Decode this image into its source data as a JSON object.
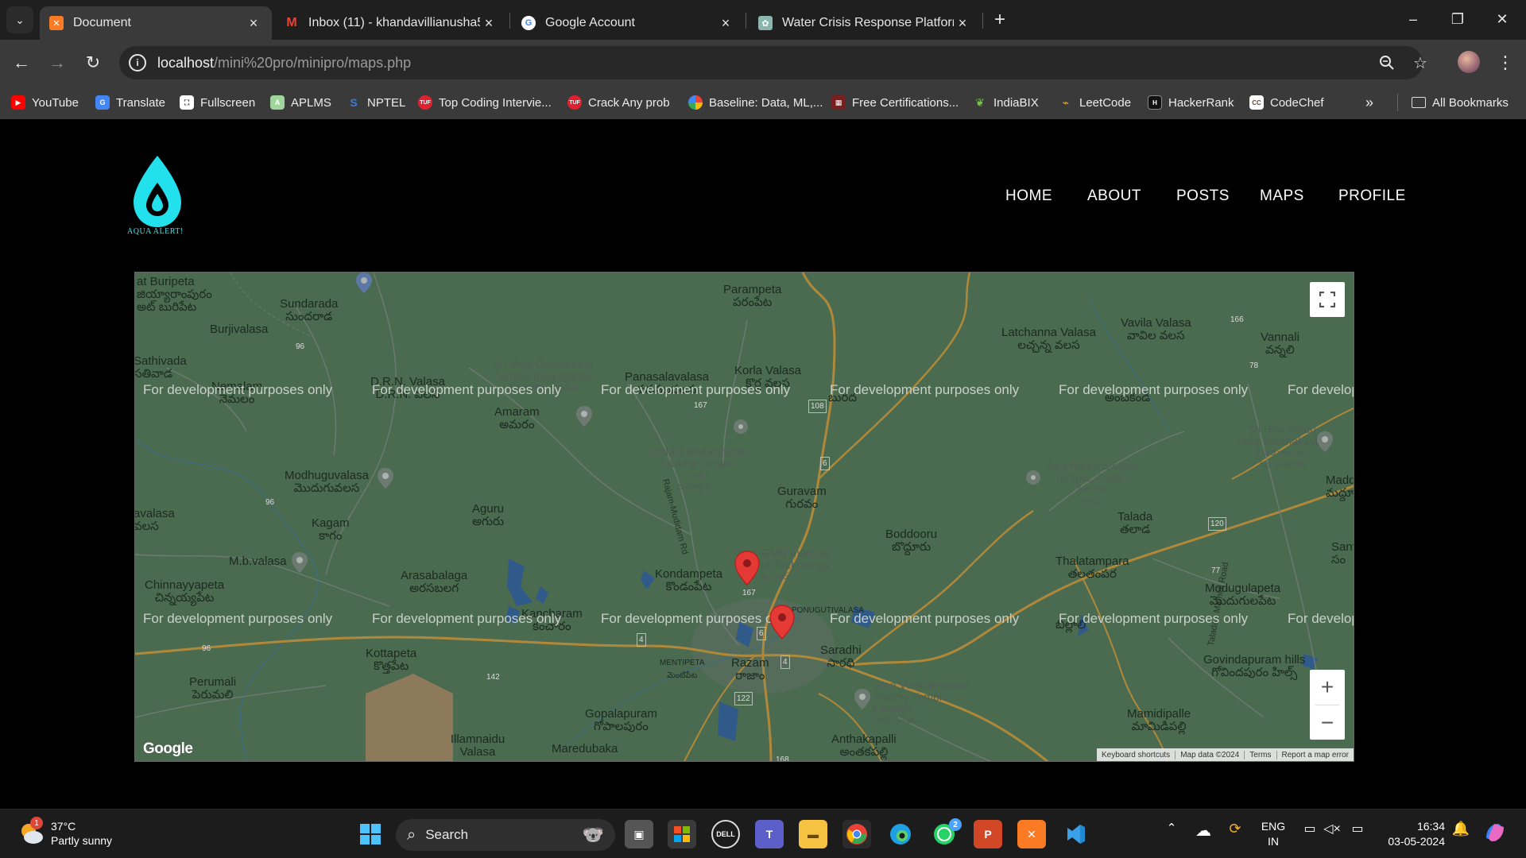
{
  "browser": {
    "tabs": [
      {
        "title": "Document",
        "active": true
      },
      {
        "title": "Inbox (11) - khandavillianusha5"
      },
      {
        "title": "Google Account"
      },
      {
        "title": "Water Crisis Response Platform"
      }
    ],
    "url_host": "localhost",
    "url_path": "/mini%20pro/minipro/maps.php",
    "bookmarks": [
      "YouTube",
      "Translate",
      "Fullscreen",
      "APLMS",
      "NPTEL",
      "Top Coding Intervie...",
      "Crack Any prob",
      "Baseline: Data, ML,...",
      "Free Certifications...",
      "IndiaBIX",
      "LeetCode",
      "HackerRank",
      "CodeChef"
    ],
    "all_bookmarks": "All Bookmarks"
  },
  "site": {
    "logo_text": "AQUA ALERT!",
    "nav": [
      "HOME",
      "ABOUT",
      "POSTS",
      "MAPS",
      "PROFILE"
    ]
  },
  "map": {
    "places": [
      {
        "name": "at Buripeta",
        "sub": "జియ్యారాంపురం\nఅట్ బురిపేట"
      },
      {
        "name": "Sundarada",
        "sub": "సుందరాడ"
      },
      {
        "name": "Burjivalasa"
      },
      {
        "name": "Sathivada",
        "sub": "సతివాడ"
      },
      {
        "name": "Nemalam",
        "sub": "నెమలం"
      },
      {
        "name": "D.R.N. Valasa",
        "sub": "D.R.N. వలస"
      },
      {
        "name": "Parampeta",
        "sub": "పరంపేట"
      },
      {
        "name": "Panasalavalasa",
        "sub": "పనసలవలస"
      },
      {
        "name": "Korla Valasa",
        "sub": "కొర్ల వలస"
      },
      {
        "name": "Latchanna Valasa",
        "sub": "లచ్చన్న వలస"
      },
      {
        "name": "Vavila Valasa",
        "sub": "వావిల వలస"
      },
      {
        "name": "Vannali",
        "sub": "వన్నలి"
      },
      {
        "name": "Amaram",
        "sub": "అమరం"
      },
      {
        "name": "Burada",
        "sub": "బురద"
      },
      {
        "name": "Ambakandi",
        "sub": "అంబకండి"
      },
      {
        "name": "Modhuguvalasa",
        "sub": "మొదుగువలస"
      },
      {
        "name": "Guravam",
        "sub": "గురవం"
      },
      {
        "name": "Aguru",
        "sub": "అగురు"
      },
      {
        "name": "Kagam",
        "sub": "కాగం"
      },
      {
        "name": "avalasa",
        "sub": "వలస"
      },
      {
        "name": "M.b.valasa"
      },
      {
        "name": "Arasabalaga",
        "sub": "అరసబలగ"
      },
      {
        "name": "Kondampeta",
        "sub": "కొండంపేట"
      },
      {
        "name": "Boddooru",
        "sub": "బొద్దూరు"
      },
      {
        "name": "Talada",
        "sub": "తలాడ"
      },
      {
        "name": "Thalatampara",
        "sub": "తలతంపర"
      },
      {
        "name": "Modugulapeta",
        "sub": "మొదుగులపేట"
      },
      {
        "name": "Chinnayyapeta",
        "sub": "చిన్నయ్యపేట"
      },
      {
        "name": "Kancharam",
        "sub": "కంచారం"
      },
      {
        "name": "Kottapeta",
        "sub": "కొత్తపేట"
      },
      {
        "name": "Razam",
        "sub": "రాజాం"
      },
      {
        "name": "Saradhi",
        "sub": "సారధి"
      },
      {
        "name": "Billali",
        "sub": "బిల్లాలి"
      },
      {
        "name": "Govindapuram hills",
        "sub": "గోవిందపురం హిల్స్"
      },
      {
        "name": "Perumali",
        "sub": "పెరుమలి"
      },
      {
        "name": "Gopalapuram",
        "sub": "గోపాలపురం"
      },
      {
        "name": "Mamidipalle",
        "sub": "మామిడిపల్లి"
      },
      {
        "name": "Illamnaidu Valasa"
      },
      {
        "name": "Maredubaka"
      },
      {
        "name": "Anthakapalli",
        "sub": "అంతకపల్లి"
      },
      {
        "name": "Madduru",
        "sub": "మద్దూరు"
      },
      {
        "name": "Sant",
        "sub": "సం"
      },
      {
        "name": "MENTIPETA",
        "sub": "మెంటిపేట"
      },
      {
        "name": "PONUGUTIVALASA"
      }
    ],
    "pois": [
      {
        "name": "Sri Majji Gowramma\nTemple (Rayagada)",
        "sub": "శ్రీ మజ్జి గౌరమ్మ టెంపుల్"
      },
      {
        "name": "Endala Mallikarjuna\nSwamy Temple",
        "sub": "ఎండల\nమల్లికార్జున..."
      },
      {
        "name": "Sita Rama Swamy\nTemple, Gulla...",
        "sub": "సీతా రామ\nస్వామి..."
      },
      {
        "name": "Sri Hari Naidu\nPeta Santhakavity",
        "sub": "శ్రీ హరి నాయుడు\nపేట సంతకవిటి"
      },
      {
        "name": "GMR Institute\nof Technology",
        "sub": "జిఎంఆర్..."
      },
      {
        "name": "Sree Venkateswara\nSwamy Temple",
        "sub": "శ్రీ వెంకటేశ్వర\nస్వామి ఆలయం"
      }
    ],
    "road_labels": [
      "96",
      "96",
      "96",
      "167",
      "108",
      "6",
      "167",
      "6",
      "4",
      "4",
      "142",
      "122",
      "168",
      "120",
      "77",
      "78",
      "166"
    ],
    "road_name": "Rajam-Mudidam Rd",
    "road_name2": "Talada - Mamidi Road",
    "dev_text": "For development purposes only",
    "attribution": [
      "Keyboard shortcuts",
      "Map data ©2024",
      "Terms",
      "Report a map error"
    ],
    "google_mark": "Google"
  },
  "taskbar": {
    "temperature": "37°C",
    "weather": "Partly sunny",
    "weather_badge": "1",
    "search_placeholder": "Search",
    "whatsapp_badge": "2",
    "lang_top": "ENG",
    "lang_bottom": "IN",
    "time": "16:34",
    "date": "03-05-2024"
  },
  "colors": {
    "map_bg": "#4a6a4f",
    "accent_cyan": "#00d2e6",
    "marker_red": "#e53935"
  }
}
